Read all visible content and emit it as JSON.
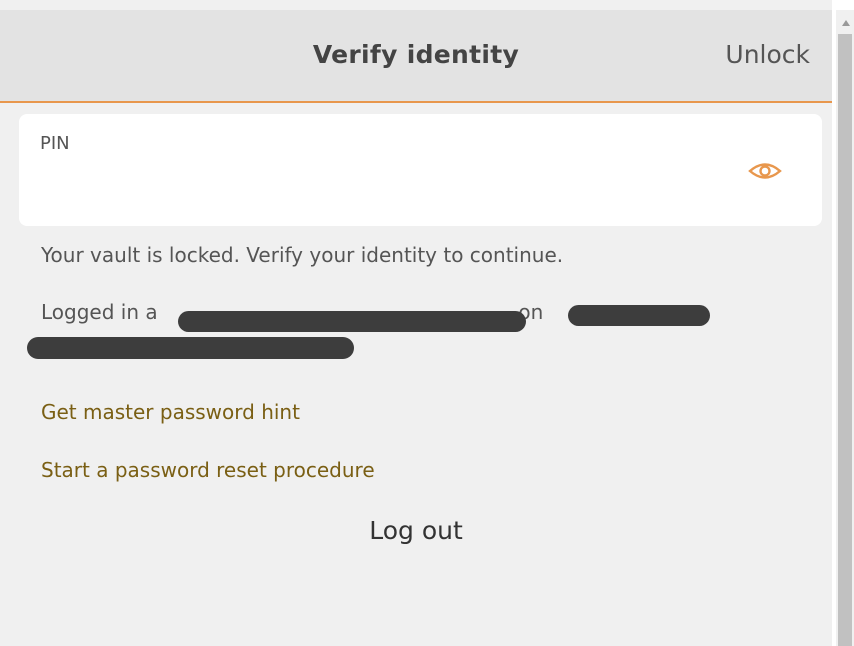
{
  "header": {
    "title": "Verify identity",
    "action": "Unlock"
  },
  "pin": {
    "label": "PIN",
    "value": "",
    "toggle_icon": "eye-icon"
  },
  "messages": {
    "locked": "Your vault is locked. Verify your identity to continue.",
    "logged_in_prefix": "Logged in a",
    "logged_in_on": "on"
  },
  "links": {
    "hint": "Get master password hint",
    "reset": "Start a password reset procedure",
    "logout": "Log out"
  },
  "colors": {
    "accent": "#e8974d",
    "link": "#7a5f14",
    "header_bg": "#e3e3e3"
  }
}
